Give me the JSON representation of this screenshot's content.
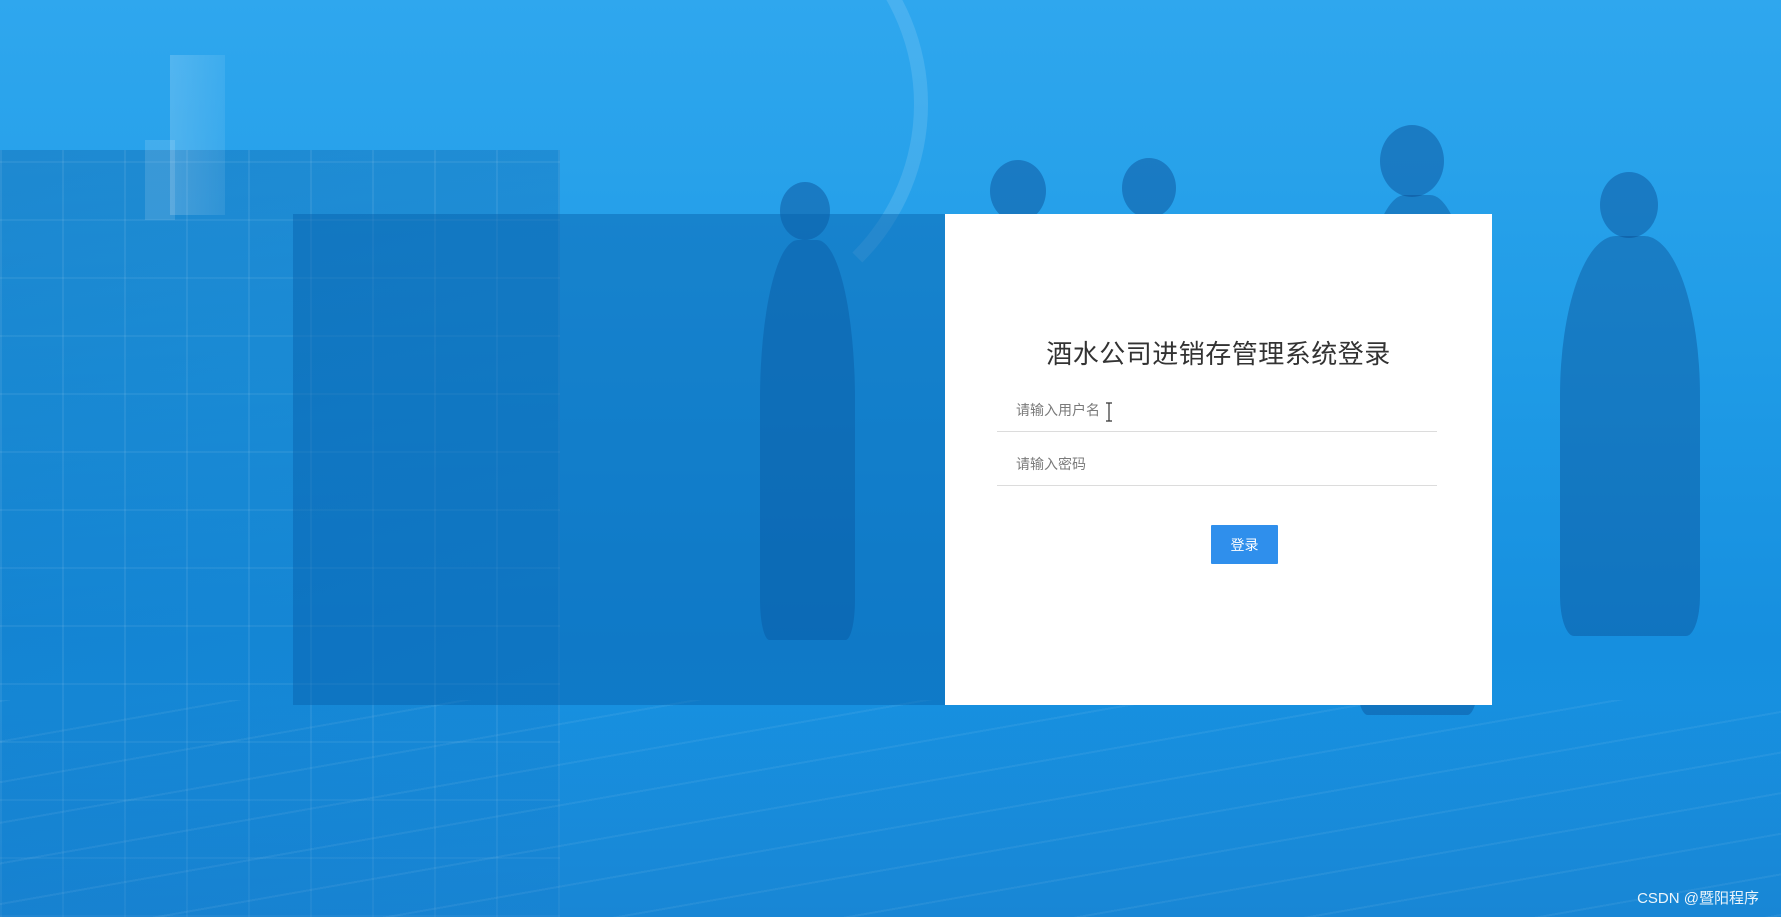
{
  "login": {
    "title": "酒水公司进销存管理系统登录",
    "username_placeholder": "请输入用户名",
    "password_placeholder": "请输入密码",
    "submit_label": "登录"
  },
  "watermark": "CSDN @暨阳程序",
  "colors": {
    "background": "#1f9be6",
    "button": "#2f8fec",
    "card": "#ffffff"
  }
}
